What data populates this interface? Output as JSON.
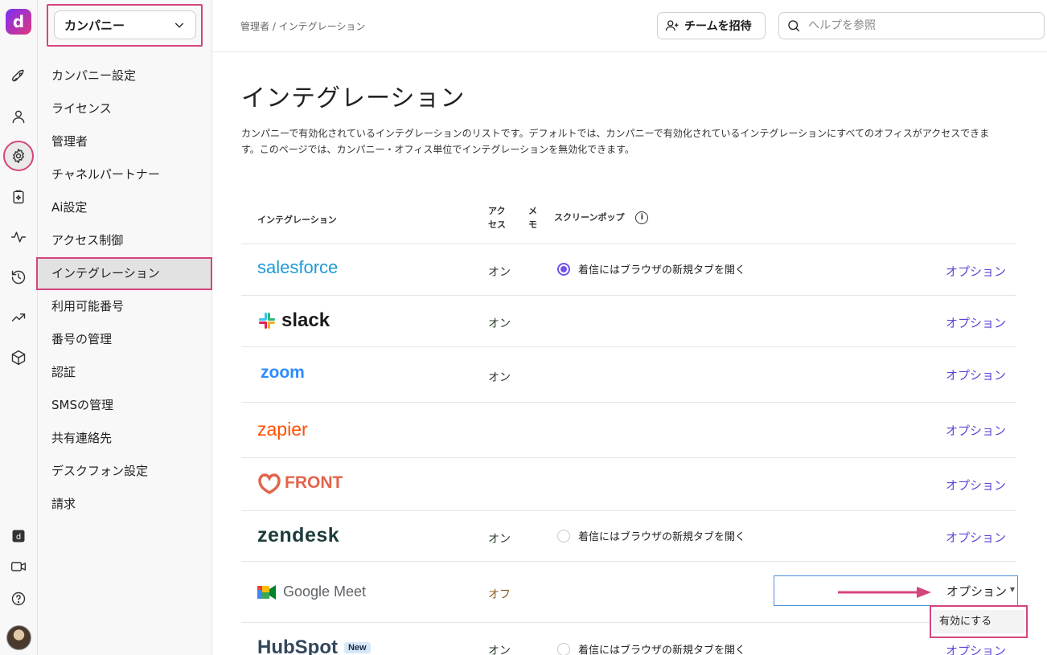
{
  "rail": {
    "logo_letter": "d",
    "items": [
      "rocket-icon",
      "person-icon",
      "gear-icon",
      "clipboard-sparkle-icon",
      "activity-icon",
      "history-icon",
      "trend-icon",
      "cube-icon"
    ],
    "bottom": [
      "dialpad-app-icon",
      "video-icon",
      "help-icon"
    ]
  },
  "sidebar": {
    "company_select": "カンパニー",
    "items": [
      {
        "label": "カンパニー設定"
      },
      {
        "label": "ライセンス"
      },
      {
        "label": "管理者"
      },
      {
        "label": "チャネルパートナー"
      },
      {
        "label": "Ai設定"
      },
      {
        "label": "アクセス制御"
      },
      {
        "label": "インテグレーション",
        "active": true
      },
      {
        "label": "利用可能番号"
      },
      {
        "label": "番号の管理"
      },
      {
        "label": "認証"
      },
      {
        "label": "SMSの管理"
      },
      {
        "label": "共有連絡先"
      },
      {
        "label": "デスクフォン設定"
      },
      {
        "label": "請求"
      }
    ]
  },
  "header": {
    "breadcrumb": "管理者 / インテグレーション",
    "invite_label": "チームを招待",
    "search_placeholder": "ヘルプを参照"
  },
  "main": {
    "title": "インテグレーション",
    "description": "カンパニーで有効化されているインテグレーションのリストです。デフォルトでは、カンパニーで有効化されているインテグレーションにすべてのオフィスがアクセスできます。このページでは、カンパニー・オフィス単位でインテグレーションを無効化できます。",
    "columns": {
      "integration": "インテグレーション",
      "access_line1": "アク",
      "access_line2": "セス",
      "memo_line1": "メ",
      "memo_line2": "モ",
      "screenpop": "スクリーンポップ"
    },
    "rows": [
      {
        "name": "salesforce",
        "access": "オン",
        "screenpop": "着信にはブラウザの新規タブを開く",
        "screenpop_checked": true,
        "options": "オプション"
      },
      {
        "name": "slack",
        "access": "オン",
        "options": "オプション"
      },
      {
        "name": "zoom",
        "access": "オン",
        "options": "オプション"
      },
      {
        "name": "zapier",
        "access": "",
        "options": "オプション"
      },
      {
        "name": "FRONT",
        "access": "",
        "options": "オプション"
      },
      {
        "name": "zendesk",
        "access": "オン",
        "screenpop": "着信にはブラウザの新規タブを開く",
        "screenpop_checked": false,
        "options": "オプション"
      },
      {
        "name": "Google Meet",
        "access": "オフ",
        "options": "オプション"
      },
      {
        "name": "HubSpot",
        "badge": "New",
        "access": "オン",
        "screenpop": "着信にはブラウザの新規タブを開く",
        "screenpop_checked": false,
        "options": "オプション"
      }
    ],
    "dropdown_menu": {
      "item": "有効にする"
    }
  },
  "colors": {
    "accent": "#5a46d6",
    "highlight": "#d4457f",
    "radio": "#7353e8"
  }
}
